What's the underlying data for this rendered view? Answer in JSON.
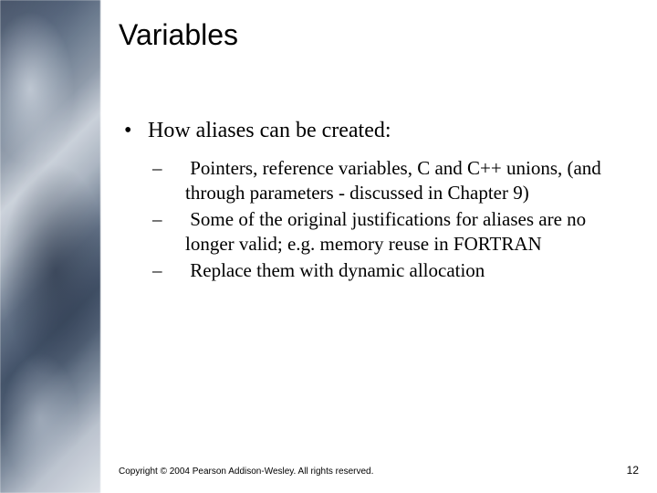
{
  "slide": {
    "title": "Variables",
    "bullet": "How aliases can be created:",
    "subitems": [
      "Pointers, reference variables, C and C++ unions, (and through parameters - discussed in Chapter 9)",
      "Some of the original justifications for aliases are no longer valid; e.g. memory reuse in FORTRAN",
      "Replace them with dynamic allocation"
    ]
  },
  "footer": {
    "copyright": "Copyright © 2004 Pearson Addison-Wesley. All rights reserved.",
    "page_number": "12"
  }
}
